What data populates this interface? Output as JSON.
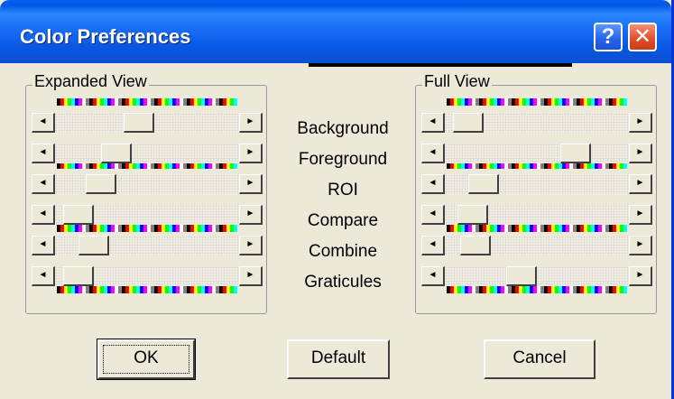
{
  "window": {
    "title": "Color Preferences",
    "help_label": "?",
    "close_label": "✕"
  },
  "expanded_view": {
    "label": "Expanded View",
    "thumb_positions_pct": [
      45,
      30,
      20,
      5,
      15,
      5
    ]
  },
  "full_view": {
    "label": "Full View",
    "thumb_positions_pct": [
      5,
      75,
      15,
      8,
      10,
      40
    ]
  },
  "rows": [
    "Background",
    "Foreground",
    "ROI",
    "Compare",
    "Combine",
    "Graticules"
  ],
  "scroll_arrows": {
    "left": "◄",
    "right": "►"
  },
  "buttons": {
    "ok": "OK",
    "default": "Default",
    "cancel": "Cancel"
  },
  "colors": {
    "titlebar": "#0054e3",
    "face": "#ece9d8",
    "close": "#e2512f"
  }
}
